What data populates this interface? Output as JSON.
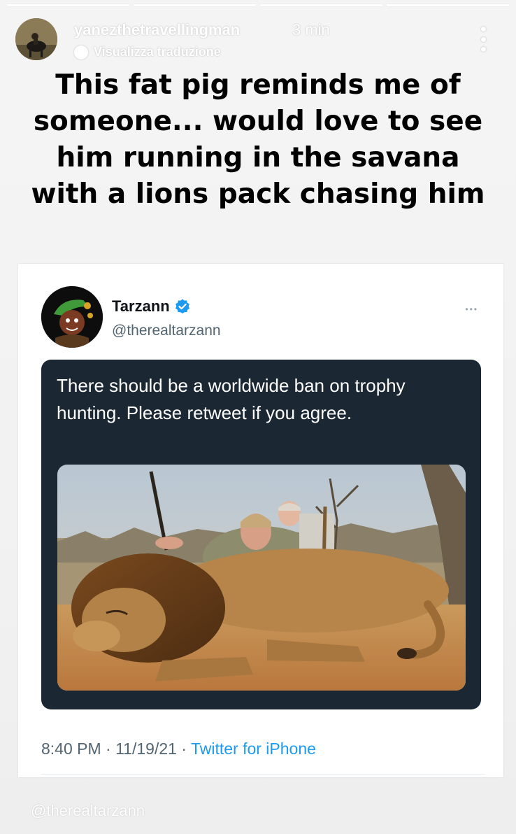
{
  "story": {
    "username": "yanezthetravellingman",
    "time_ago": "3 min",
    "translate_label": "Visualizza traduzione",
    "caption": "This fat pig reminds me of someone... would love to see him running in the savana with a lions pack chasing him"
  },
  "tweet": {
    "display_name": "Tarzann",
    "handle": "@therealtarzann",
    "text": "There should be a worldwide ban on trophy hunting. Please retweet if you agree.",
    "meta_time": "8:40 PM · 11/19/21 · ",
    "meta_source": "Twitter for iPhone",
    "photo_alt": "hunters posing behind a dead lion"
  },
  "watermark": "@therealtarzann",
  "icons": [
    "verified-badge-icon",
    "more-options-icon",
    "globe-icon"
  ],
  "colors": {
    "verified": "#1d9bf0",
    "card_bg": "#1b2733",
    "link": "#1d9bf0"
  }
}
